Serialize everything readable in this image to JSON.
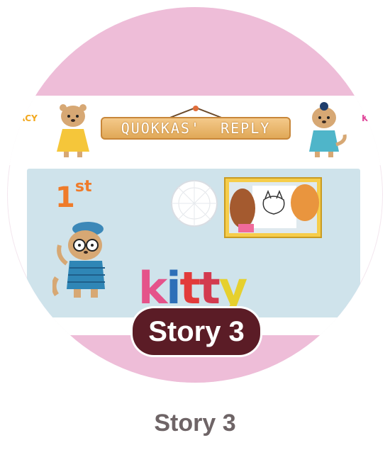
{
  "thumbnail": {
    "header_left_text": "ACY",
    "header_right_text": "K",
    "sign_text": "QUOKKAS'  REPLY",
    "rank": {
      "number": "1",
      "suffix": "st"
    },
    "word_letters": [
      "k",
      "i",
      "t",
      "t",
      "y"
    ],
    "word_colors": [
      "#e5538a",
      "#2d6fb8",
      "#e23a3a",
      "#d33a4f",
      "#e6d02e"
    ],
    "badge_text": "Story 3"
  },
  "caption": "Story 3",
  "colors": {
    "pink_band": "#eebdd8",
    "banner_blue": "#cfe3eb",
    "badge_bg": "#5b1c26",
    "caption_text": "#6e6466"
  }
}
